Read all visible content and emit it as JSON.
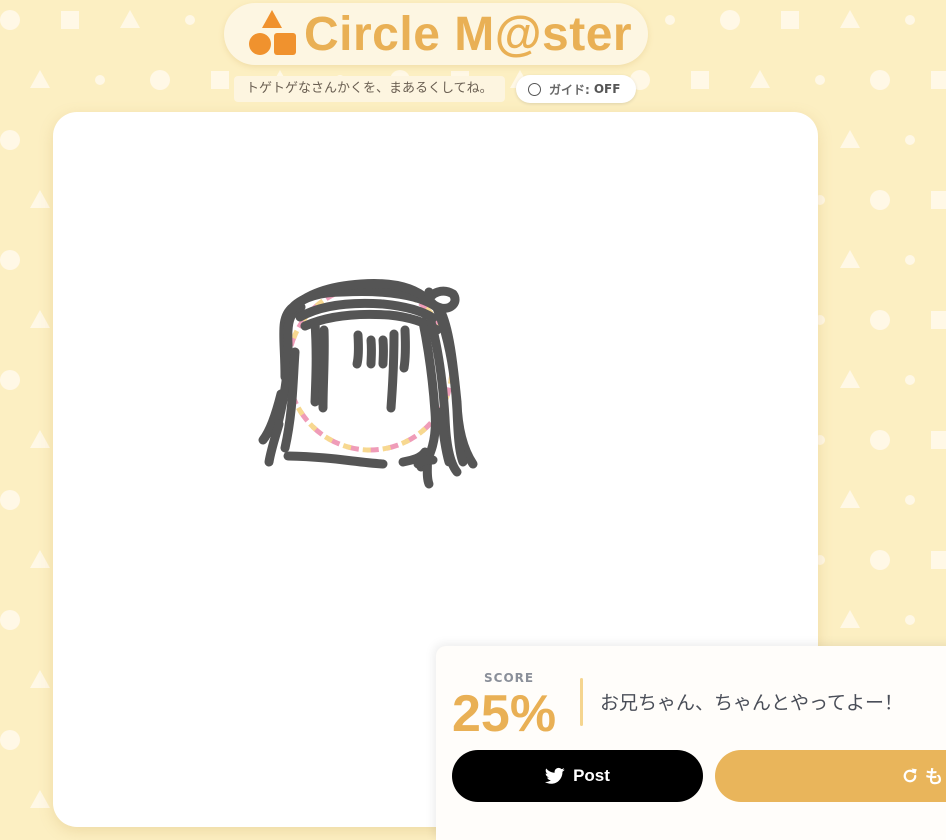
{
  "app": {
    "title": "Circle M@ster",
    "subtitle": "トゲトゲなさんかくを、まあるくしてね。"
  },
  "guide": {
    "label": "ガイド:",
    "state": "OFF"
  },
  "result": {
    "score_label": "SCORE",
    "score_value": "25%",
    "message": "お兄ちゃん、ちゃんとやってよー！",
    "post_label": "Post",
    "retry_label": "も"
  },
  "colors": {
    "background": "#fcefc2",
    "accent": "#e9b055",
    "logo": "#f0922e",
    "stroke": "#555555",
    "guide_pink": "#ef9cb8",
    "guide_yellow": "#f7d890"
  },
  "icons": {
    "logo": "triangle-circle-square-logo-icon",
    "guide": "radio-off-icon",
    "post": "twitter-bird-icon",
    "retry": "refresh-icon"
  }
}
